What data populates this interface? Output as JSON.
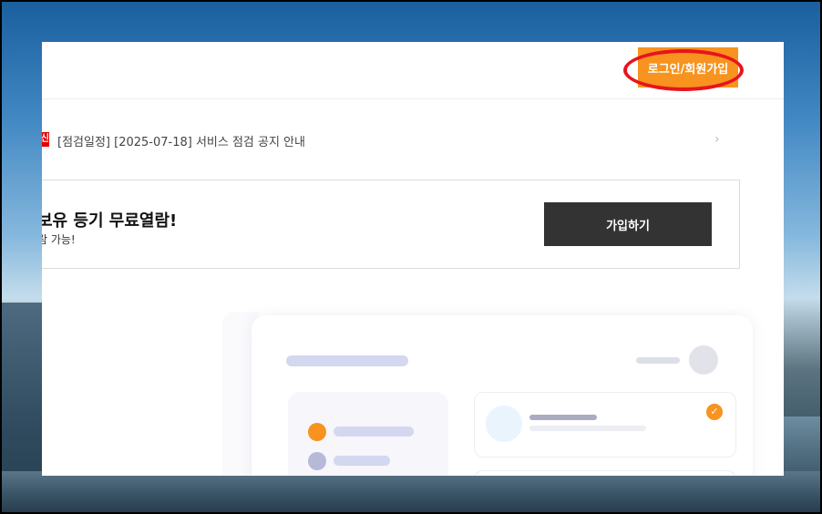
{
  "header": {
    "login_label": "로그인/회원가입"
  },
  "notice": {
    "badge": "신",
    "text": "[점검일정] [2025-07-18] 서비스 점검 공지 안내",
    "chevron": "›"
  },
  "promo": {
    "title": "보유 등기 무료열람!",
    "subtitle": "람 가능!",
    "join_label": "가입하기"
  },
  "illustration": {
    "check": "✓"
  },
  "colors": {
    "accent": "#f7931e",
    "dark_button": "#333333",
    "badge_red": "#e00000",
    "annotation_red": "#e8141c"
  },
  "icons": {
    "chevron": "chevron-right-icon",
    "check": "check-icon"
  }
}
